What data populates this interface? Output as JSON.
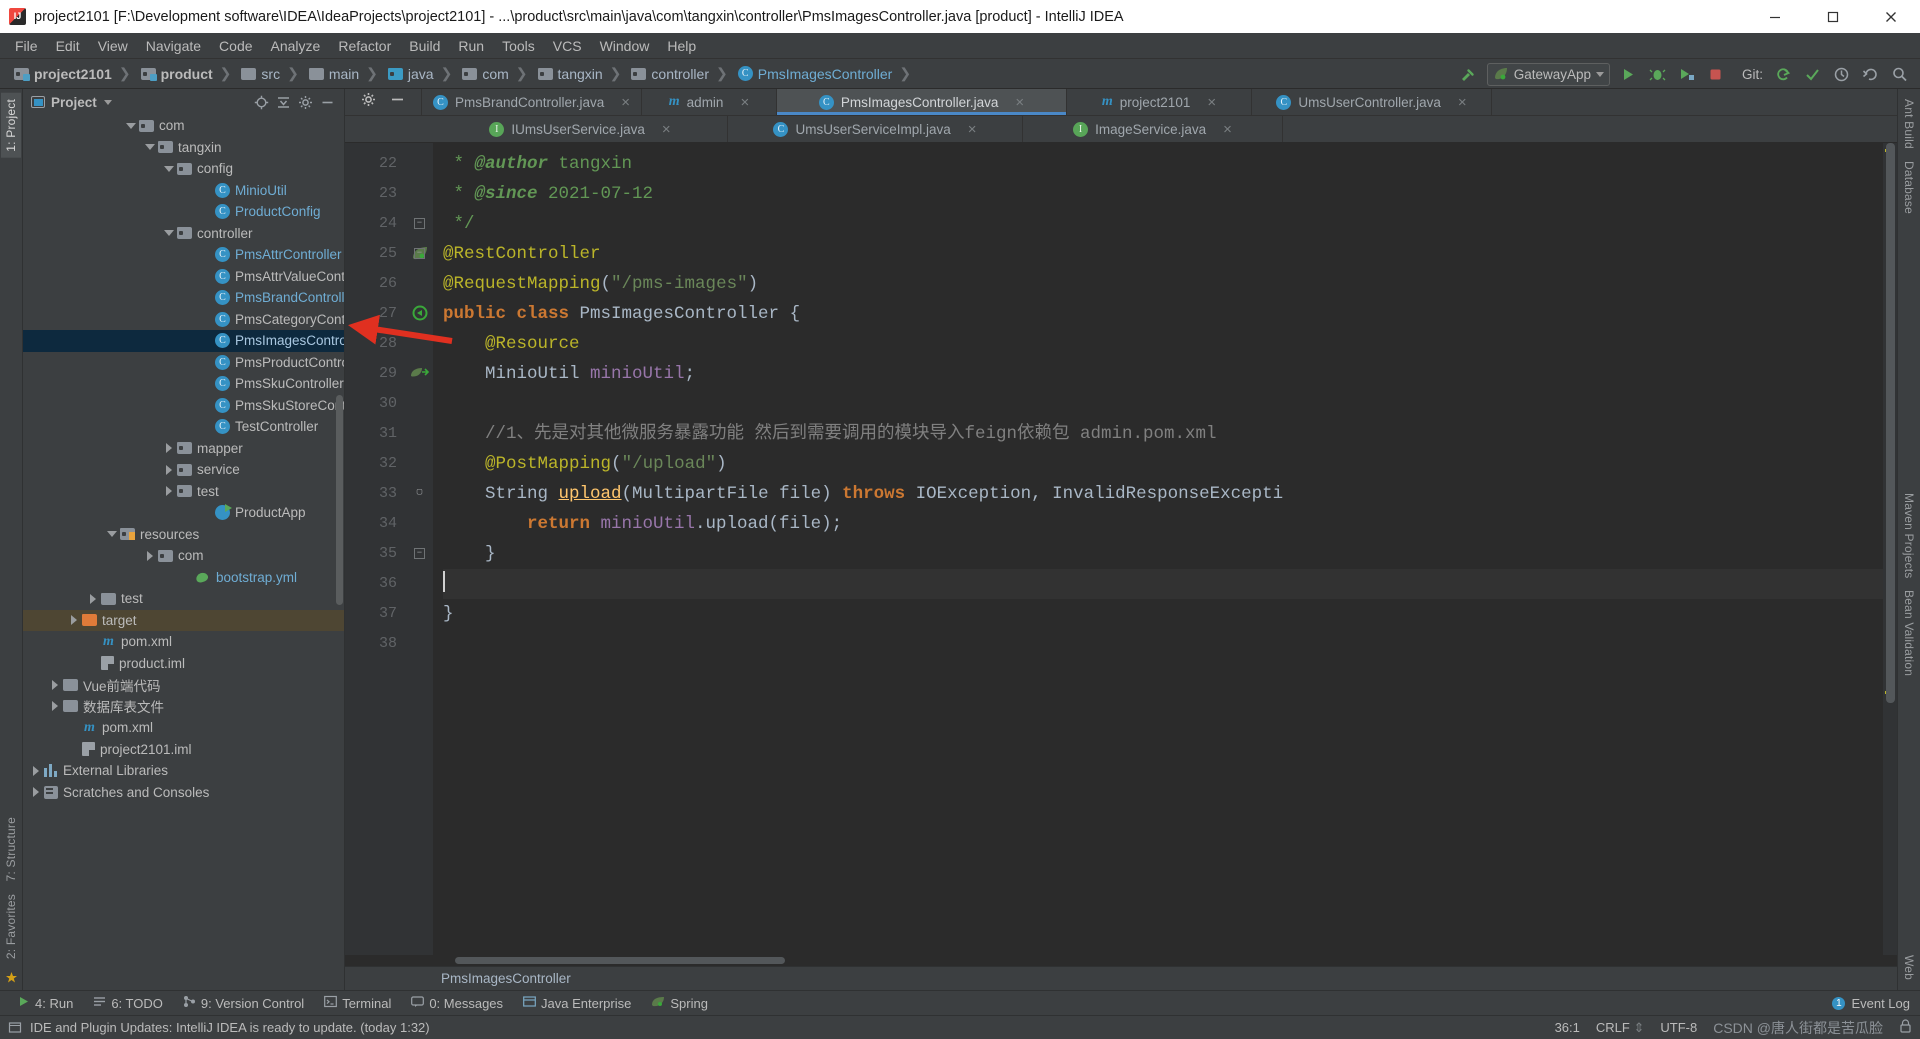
{
  "window": {
    "title": "project2101 [F:\\Development software\\IDEA\\IdeaProjects\\project2101] - ...\\product\\src\\main\\java\\com\\tangxin\\controller\\PmsImagesController.java [product] - IntelliJ IDEA",
    "minimize": "minimize-icon",
    "maximize": "maximize-icon",
    "close": "close-icon"
  },
  "menu": [
    "File",
    "Edit",
    "View",
    "Navigate",
    "Code",
    "Analyze",
    "Refactor",
    "Build",
    "Run",
    "Tools",
    "VCS",
    "Window",
    "Help"
  ],
  "navbar": {
    "crumbs": [
      {
        "label": "project2101",
        "icon": "module-folder-icon",
        "bold": true
      },
      {
        "label": "product",
        "icon": "module-folder-icon",
        "bold": true
      },
      {
        "label": "src",
        "icon": "folder-icon",
        "bold": false
      },
      {
        "label": "main",
        "icon": "folder-icon",
        "bold": false
      },
      {
        "label": "java",
        "icon": "source-root-folder-icon",
        "bold": false
      },
      {
        "label": "com",
        "icon": "package-icon",
        "bold": false
      },
      {
        "label": "tangxin",
        "icon": "package-icon",
        "bold": false
      },
      {
        "label": "controller",
        "icon": "package-icon",
        "bold": false
      },
      {
        "label": "PmsImagesController",
        "icon": "class-icon",
        "bold": false
      }
    ],
    "run_config": "GatewayApp",
    "git_label": "Git:"
  },
  "project_panel": {
    "title": "Project",
    "tree": [
      {
        "label": "com",
        "indent": 5,
        "arrow": "down",
        "icon": "package-icon",
        "color": "grey"
      },
      {
        "label": "tangxin",
        "indent": 6,
        "arrow": "down",
        "icon": "package-icon",
        "color": "grey"
      },
      {
        "label": "config",
        "indent": 7,
        "arrow": "down",
        "icon": "package-icon",
        "color": "grey"
      },
      {
        "label": "MinioUtil",
        "indent": 9,
        "arrow": "none",
        "icon": "class-icon",
        "color": "blue"
      },
      {
        "label": "ProductConfig",
        "indent": 9,
        "arrow": "none",
        "icon": "class-icon",
        "color": "blue"
      },
      {
        "label": "controller",
        "indent": 7,
        "arrow": "down",
        "icon": "package-icon",
        "color": "grey"
      },
      {
        "label": "PmsAttrController",
        "indent": 9,
        "arrow": "none",
        "icon": "class-icon",
        "color": "blue"
      },
      {
        "label": "PmsAttrValueController",
        "indent": 9,
        "arrow": "none",
        "icon": "class-icon",
        "color": "grey"
      },
      {
        "label": "PmsBrandController",
        "indent": 9,
        "arrow": "none",
        "icon": "class-icon",
        "color": "blue"
      },
      {
        "label": "PmsCategoryController",
        "indent": 9,
        "arrow": "none",
        "icon": "class-icon",
        "color": "grey"
      },
      {
        "label": "PmsImagesController",
        "indent": 9,
        "arrow": "none",
        "icon": "class-icon",
        "color": "blue",
        "selected": true
      },
      {
        "label": "PmsProductController",
        "indent": 9,
        "arrow": "none",
        "icon": "class-icon",
        "color": "grey"
      },
      {
        "label": "PmsSkuController",
        "indent": 9,
        "arrow": "none",
        "icon": "class-icon",
        "color": "grey"
      },
      {
        "label": "PmsSkuStoreController",
        "indent": 9,
        "arrow": "none",
        "icon": "class-icon",
        "color": "grey"
      },
      {
        "label": "TestController",
        "indent": 9,
        "arrow": "none",
        "icon": "class-icon",
        "color": "grey"
      },
      {
        "label": "mapper",
        "indent": 7,
        "arrow": "right",
        "icon": "package-icon",
        "color": "grey"
      },
      {
        "label": "service",
        "indent": 7,
        "arrow": "right",
        "icon": "package-icon",
        "color": "grey"
      },
      {
        "label": "test",
        "indent": 7,
        "arrow": "right",
        "icon": "package-icon",
        "color": "grey"
      },
      {
        "label": "ProductApp",
        "indent": 9,
        "arrow": "none",
        "icon": "runnable-class-icon",
        "color": "grey"
      },
      {
        "label": "resources",
        "indent": 4,
        "arrow": "down",
        "icon": "resources-folder-icon",
        "color": "grey"
      },
      {
        "label": "com",
        "indent": 6,
        "arrow": "right",
        "icon": "package-icon",
        "color": "grey"
      },
      {
        "label": "bootstrap.yml",
        "indent": 8,
        "arrow": "none",
        "icon": "yaml-icon",
        "color": "blue"
      },
      {
        "label": "test",
        "indent": 3,
        "arrow": "right",
        "icon": "folder-icon",
        "color": "grey"
      },
      {
        "label": "target",
        "indent": 2,
        "arrow": "right",
        "icon": "target-folder-icon",
        "color": "grey",
        "highlight": true
      },
      {
        "label": "pom.xml",
        "indent": 3,
        "arrow": "none",
        "icon": "maven-icon",
        "color": "grey"
      },
      {
        "label": "product.iml",
        "indent": 3,
        "arrow": "none",
        "icon": "iml-icon",
        "color": "grey"
      },
      {
        "label": "Vue前端代码",
        "indent": 1,
        "arrow": "right",
        "icon": "folder-icon",
        "color": "grey"
      },
      {
        "label": "数据库表文件",
        "indent": 1,
        "arrow": "right",
        "icon": "folder-icon",
        "color": "grey"
      },
      {
        "label": "pom.xml",
        "indent": 2,
        "arrow": "none",
        "icon": "maven-icon",
        "color": "grey"
      },
      {
        "label": "project2101.iml",
        "indent": 2,
        "arrow": "none",
        "icon": "iml-icon",
        "color": "grey"
      },
      {
        "label": "External Libraries",
        "indent": 0,
        "arrow": "right",
        "icon": "libraries-icon",
        "color": "grey"
      },
      {
        "label": "Scratches and Consoles",
        "indent": 0,
        "arrow": "right",
        "icon": "scratches-icon",
        "color": "grey"
      }
    ]
  },
  "left_strip": {
    "top": [
      "1: Project"
    ],
    "bottom": [
      "7: Structure",
      "2: Favorites"
    ]
  },
  "right_strip": {
    "top": [
      "Ant Build",
      "Database"
    ],
    "middle": [
      "Maven Projects",
      "Bean Validation"
    ],
    "bottom": [
      "Web"
    ]
  },
  "editor": {
    "tabs_row1": [
      {
        "label": "PmsBrandController.java",
        "icon": "class-icon",
        "active": false
      },
      {
        "label": "admin",
        "icon": "maven-module-icon",
        "active": false
      },
      {
        "label": "PmsImagesController.java",
        "icon": "class-icon",
        "active": true
      },
      {
        "label": "project2101",
        "icon": "maven-module-icon",
        "active": false
      },
      {
        "label": "UmsUserController.java",
        "icon": "class-icon",
        "active": false
      }
    ],
    "tabs_row2": [
      {
        "label": "IUmsUserService.java",
        "icon": "interface-icon",
        "active": false
      },
      {
        "label": "UmsUserServiceImpl.java",
        "icon": "class-icon",
        "active": false
      },
      {
        "label": "ImageService.java",
        "icon": "interface-icon",
        "active": false
      }
    ],
    "line_numbers": [
      "22",
      "23",
      "24",
      "25",
      "26",
      "27",
      "28",
      "29",
      "30",
      "31",
      "32",
      "33",
      "34",
      "35",
      "36",
      "37",
      "38"
    ],
    "code_lines": [
      " * @author tangxin",
      " * @since 2021-07-12",
      " */",
      "@RestController",
      "@RequestMapping(\"/pms-images\")",
      "public class PmsImagesController {",
      "    @Resource",
      "    MinioUtil minioUtil;",
      "",
      "    //1、先是对其他微服务暴露功能 然后到需要调用的模块导入feign依赖包 admin.pom.xml",
      "    @PostMapping(\"/upload\")",
      "    String upload(MultipartFile file) throws IOException, InvalidResponseExcepti",
      "        return minioUtil.upload(file);",
      "    }",
      "",
      "}",
      ""
    ],
    "breadcrumb_bottom": "PmsImagesController"
  },
  "bottom_bar": {
    "items": [
      {
        "label": "4: Run",
        "icon": "run-icon"
      },
      {
        "label": "6: TODO",
        "icon": "todo-icon"
      },
      {
        "label": "9: Version Control",
        "icon": "vcs-icon"
      },
      {
        "label": "Terminal",
        "icon": "terminal-icon"
      },
      {
        "label": "0: Messages",
        "icon": "messages-icon"
      },
      {
        "label": "Java Enterprise",
        "icon": "java-enterprise-icon"
      },
      {
        "label": "Spring",
        "icon": "spring-icon"
      }
    ],
    "event_log": "Event Log"
  },
  "status_bar": {
    "message": "IDE and Plugin Updates: IntelliJ IDEA is ready to update. (today 1:32)",
    "caret_position": "36:1",
    "line_separator": "CRLF",
    "encoding": "UTF-8",
    "watermark": "CSDN @唐人街都是苦瓜脸"
  },
  "colors": {
    "accent": "#4a88c7",
    "selection": "#0d293e",
    "highlight": "#4e4633",
    "keyword": "#cc7832",
    "annotation": "#bbb529",
    "string": "#6a8759",
    "comment": "#808080",
    "field": "#9876aa",
    "method": "#ffc66d",
    "doc": "#629755",
    "arrow_annotation": "#e03020"
  }
}
